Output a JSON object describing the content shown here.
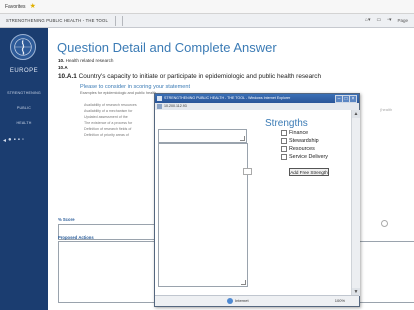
{
  "browser": {
    "favorites_label": "Favorites",
    "tab_title": "STRENGTHENING PUBLIC HEALTH - THE TOOL",
    "tools": "Page"
  },
  "sidebar": {
    "org_label": "EUROPE",
    "nav_items": [
      "STRENGTHENING",
      "PUBLIC",
      "HEALTH"
    ]
  },
  "page": {
    "title": "Question Detail and Complete Answer",
    "breadcrumb_1": {
      "code": "10.",
      "text": "Health related research"
    },
    "breadcrumb_2": {
      "code": "10.A"
    },
    "question": {
      "code": "10.A.1",
      "text": "Country's capacity to initiate or participate in epidemiologic and public health research"
    },
    "instruction_title": "Please to consider in scoring your statement",
    "instruction_subtitle": "Examples for epidemiologic and public health",
    "bullets": [
      "Availability of research resources",
      "Availability of a mechanism for",
      "Updated assessment of the",
      "The existence of a process for",
      "Definition of research fields of",
      "Definition of priority areas of"
    ],
    "score_label": "% Score",
    "actions_label": "Proposed Actions",
    "right_note": "(health"
  },
  "popup": {
    "title_bar": "STRENGTHENING PUBLIC HEALTH - THE TOOL - Windows Internet Explorer",
    "address": "10.200.112.93",
    "heading": "Strengths",
    "checkboxes": [
      "Finance",
      "Stewardship",
      "Resources",
      "Service Delivery"
    ],
    "add_button": "Add Free Strength",
    "status_zone": "Internet",
    "zoom": "100%"
  },
  "colors": {
    "sidebar_bg": "#1b3d70",
    "accent_blue": "#3b7bb5",
    "titlebar_blue": "#2a5598"
  }
}
